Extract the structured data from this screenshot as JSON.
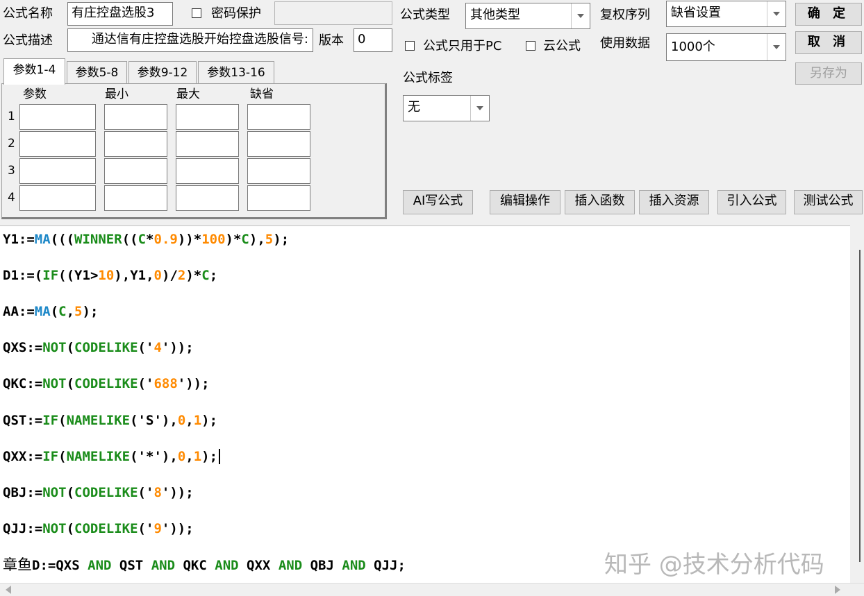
{
  "header": {
    "name_label": "公式名称",
    "name_value": "有庄控盘选股3",
    "password_label": "密码保护",
    "password_checked": false,
    "desc_label": "公式描述",
    "desc_value": "通达信有庄控盘选股开始控盘选股信号:",
    "version_label": "版本",
    "version_value": "0",
    "type_label": "公式类型",
    "type_value": "其他类型",
    "rights_label": "复权序列",
    "rights_value": "缺省设置",
    "pc_only_label": "公式只用于PC",
    "pc_only_checked": false,
    "cloud_label": "云公式",
    "cloud_checked": false,
    "data_label": "使用数据",
    "data_value": "1000个",
    "tag_label": "公式标签",
    "tag_value": "无"
  },
  "side_buttons": {
    "ok": "确 定",
    "cancel": "取 消",
    "save_as": "另存为"
  },
  "param_tabs": [
    "参数1-4",
    "参数5-8",
    "参数9-12",
    "参数13-16"
  ],
  "param_table": {
    "headers": [
      "参数",
      "最小",
      "最大",
      "缺省"
    ],
    "rows": [
      "1",
      "2",
      "3",
      "4"
    ]
  },
  "toolbar": {
    "ai": "AI写公式",
    "edit": "编辑操作",
    "insert_func": "插入函数",
    "insert_res": "插入资源",
    "import": "引入公式",
    "test": "测试公式"
  },
  "code_lines": [
    "Y1:=MA(((WINNER((C*0.9))*100)*C),5);",
    "D1:=(IF((Y1>10),Y1,0)/2)*C;",
    "AA:=MA(C,5);",
    "QXS:=NOT(CODELIKE('4'));",
    "QKC:=NOT(CODELIKE('688'));",
    "QST:=IF(NAMELIKE('S'),0,1);",
    "QXX:=IF(NAMELIKE('*'),0,1);",
    "QBJ:=NOT(CODELIKE('8'));",
    "QJJ:=NOT(CODELIKE('9'));",
    "章鱼D:=QXS AND QST AND QKC AND QXX AND QBJ AND QJJ;"
  ],
  "watermark": "知乎 @技术分析代码",
  "colors": {
    "keyword": "#1a8c1a",
    "function_ma": "#1e88c8",
    "number": "#ff8a00",
    "text": "#000000"
  }
}
